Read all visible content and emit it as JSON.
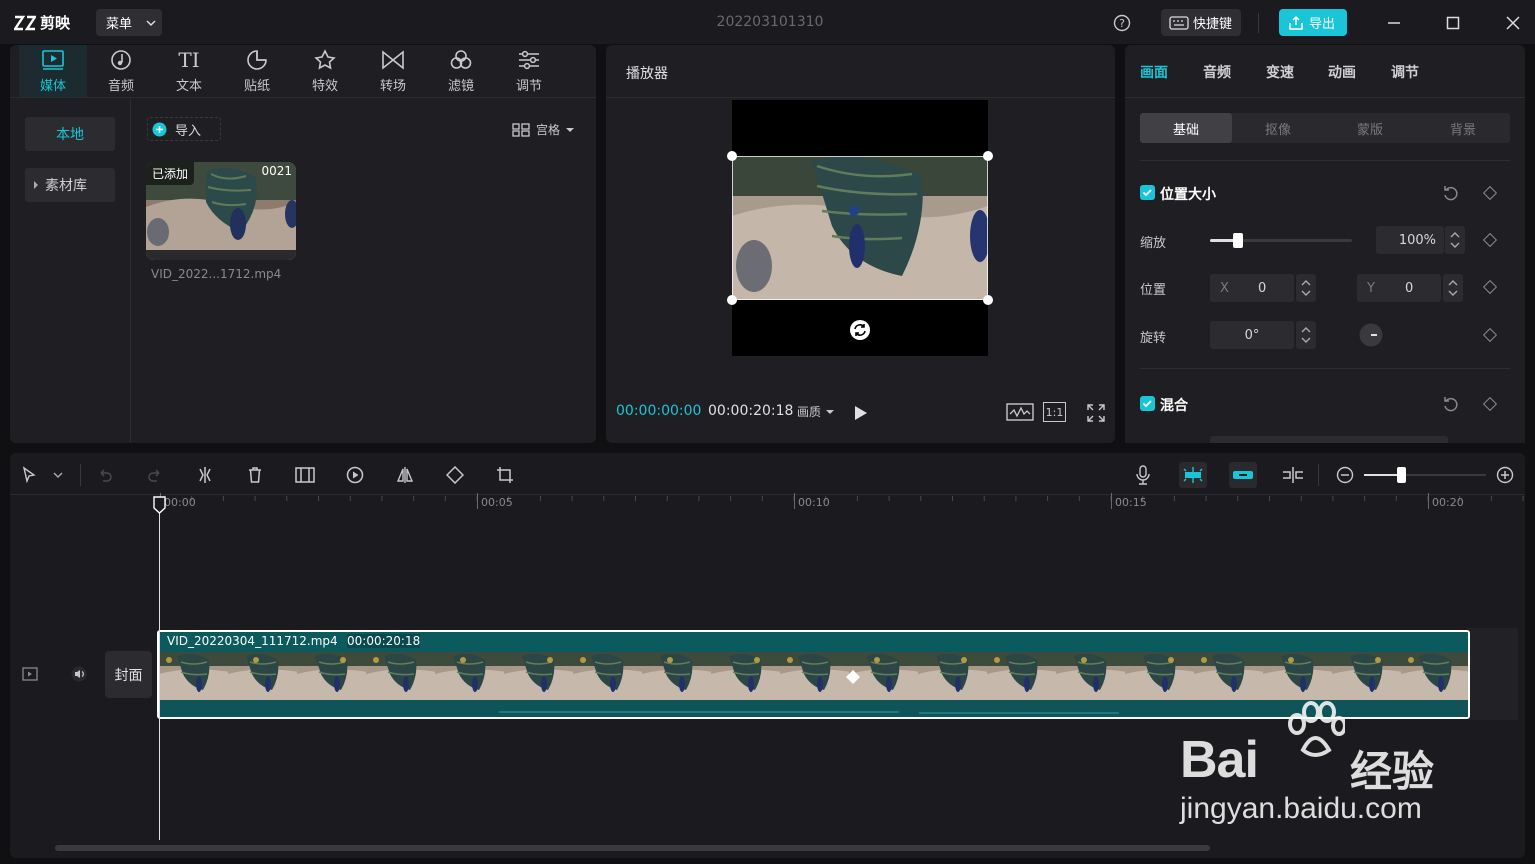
{
  "app": {
    "logo_text": "剪映",
    "menu_label": "菜单",
    "project_title": "202203101310",
    "shortcuts_label": "快捷键",
    "export_label": "导出"
  },
  "media_tabs": [
    {
      "label": "媒体",
      "icon": "media-icon"
    },
    {
      "label": "音频",
      "icon": "audio-icon"
    },
    {
      "label": "文本",
      "icon": "text-icon"
    },
    {
      "label": "贴纸",
      "icon": "sticker-icon"
    },
    {
      "label": "特效",
      "icon": "effects-icon"
    },
    {
      "label": "转场",
      "icon": "transition-icon"
    },
    {
      "label": "滤镜",
      "icon": "filter-icon"
    },
    {
      "label": "调节",
      "icon": "adjust-icon"
    }
  ],
  "media_panel": {
    "side_local": "本地",
    "side_library": "素材库",
    "import_label": "导入",
    "view_label": "宫格",
    "clip": {
      "added_badge": "已添加",
      "duration_badge": "0021",
      "filename": "VID_2022...1712.mp4"
    }
  },
  "player": {
    "title": "播放器",
    "current_time": "00:00:00:00",
    "total_time": "00:00:20:18",
    "quality_label": "画质",
    "ratio_label": "1:1"
  },
  "inspector": {
    "tabs": [
      "画面",
      "音频",
      "变速",
      "动画",
      "调节"
    ],
    "subtabs": [
      "基础",
      "抠像",
      "蒙版",
      "背景"
    ],
    "position_size": {
      "section_label": "位置大小",
      "scale_label": "缩放",
      "scale_value": "100%",
      "scale_level": 0.2,
      "position_label": "位置",
      "x_label": "X",
      "x_value": "0",
      "y_label": "Y",
      "y_value": "0",
      "rotation_label": "旋转",
      "rotation_value": "0°"
    },
    "blend": {
      "section_label": "混合"
    }
  },
  "timeline": {
    "ruler_labels": [
      "00:00",
      "00:05",
      "00:10",
      "00:15",
      "00:20"
    ],
    "clip_name": "VID_20220304_111712.mp4",
    "clip_duration": "00:00:20:18",
    "cover_label": "封面",
    "zoom_level": 0.3
  },
  "watermark": {
    "brand": "Bai",
    "brand_suffix": "经验",
    "url": "jingyan.baidu.com"
  },
  "colors": {
    "accent": "#19c5d6",
    "clip_bg": "#0b5a5e",
    "panel": "#1f1f23"
  }
}
